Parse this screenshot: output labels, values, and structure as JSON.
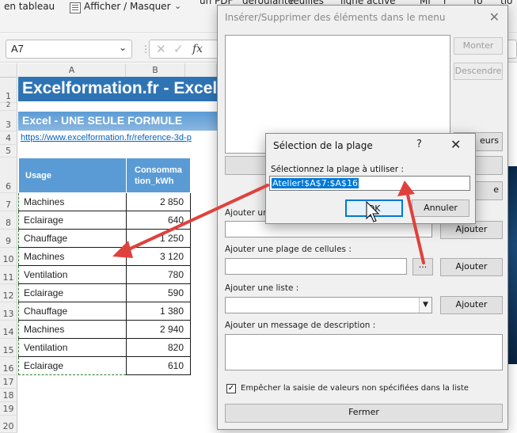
{
  "ribbon": {
    "items": [
      "en tableau",
      "Afficher / Masquer",
      "un PDF",
      "déroulante",
      "feuilles",
      "ligne active",
      "Mi",
      "r",
      "fo",
      "tio"
    ]
  },
  "formula_bar": {
    "name_box": "A7",
    "fx": "fx"
  },
  "columns": [
    "A",
    "B"
  ],
  "rows": [
    "1",
    "2",
    "3",
    "4",
    "5",
    "6",
    "7",
    "8",
    "9",
    "10",
    "11",
    "12",
    "13",
    "14",
    "15",
    "16",
    "17",
    "18",
    "19",
    "20"
  ],
  "sheet": {
    "banner_title": "Excelformation.fr - Excel",
    "subtitle": "Excel - UNE SEULE FORMULE",
    "link": "https://www.excelformation.fr/reference-3d-p",
    "table": {
      "headers": [
        "Usage",
        "Consommation_kWh"
      ],
      "rows": [
        [
          "Machines",
          "2 850"
        ],
        [
          "Eclairage",
          "640"
        ],
        [
          "Chauffage",
          "1 250"
        ],
        [
          "Machines",
          "3 120"
        ],
        [
          "Ventilation",
          "780"
        ],
        [
          "Eclairage",
          "590"
        ],
        [
          "Chauffage",
          "1 380"
        ],
        [
          "Machines",
          "2 940"
        ],
        [
          "Ventilation",
          "820"
        ],
        [
          "Eclairage",
          "610"
        ]
      ]
    }
  },
  "main_dialog": {
    "title": "Insérer/Supprimer des éléments dans le menu",
    "monter": "Monter",
    "descendre": "Descendre",
    "side_btn_1": "eurs",
    "side_btn_2": "e",
    "label_add_value": "Ajouter un",
    "label_add_range": "Ajouter une plage de cellules :",
    "label_add_list": "Ajouter une liste :",
    "label_add_message": "Ajouter un message de description :",
    "ajouter": "Ajouter",
    "browse": "...",
    "checkbox_label": "Empêcher la saisie de valeurs non spécifiées dans la liste",
    "checkbox_checked": true,
    "fermer": "Fermer"
  },
  "range_dialog": {
    "title": "Sélection de la plage",
    "help": "?",
    "prompt": "Sélectionnez la plage à utiliser :",
    "value": "Atelier!$A$7:$A$16",
    "ok": "OK",
    "cancel": "Annuler"
  },
  "colors": {
    "accent": "#2e74b5",
    "header_fill": "#5b9bd5",
    "arrow": "#e0413c",
    "focus": "#0078d7"
  },
  "icons": [
    "show-hide-icon",
    "dropdown-arrow-icon",
    "cancel-x-icon",
    "confirm-check-icon",
    "fx-icon",
    "close-icon",
    "help-icon",
    "mouse-cursor-icon"
  ]
}
